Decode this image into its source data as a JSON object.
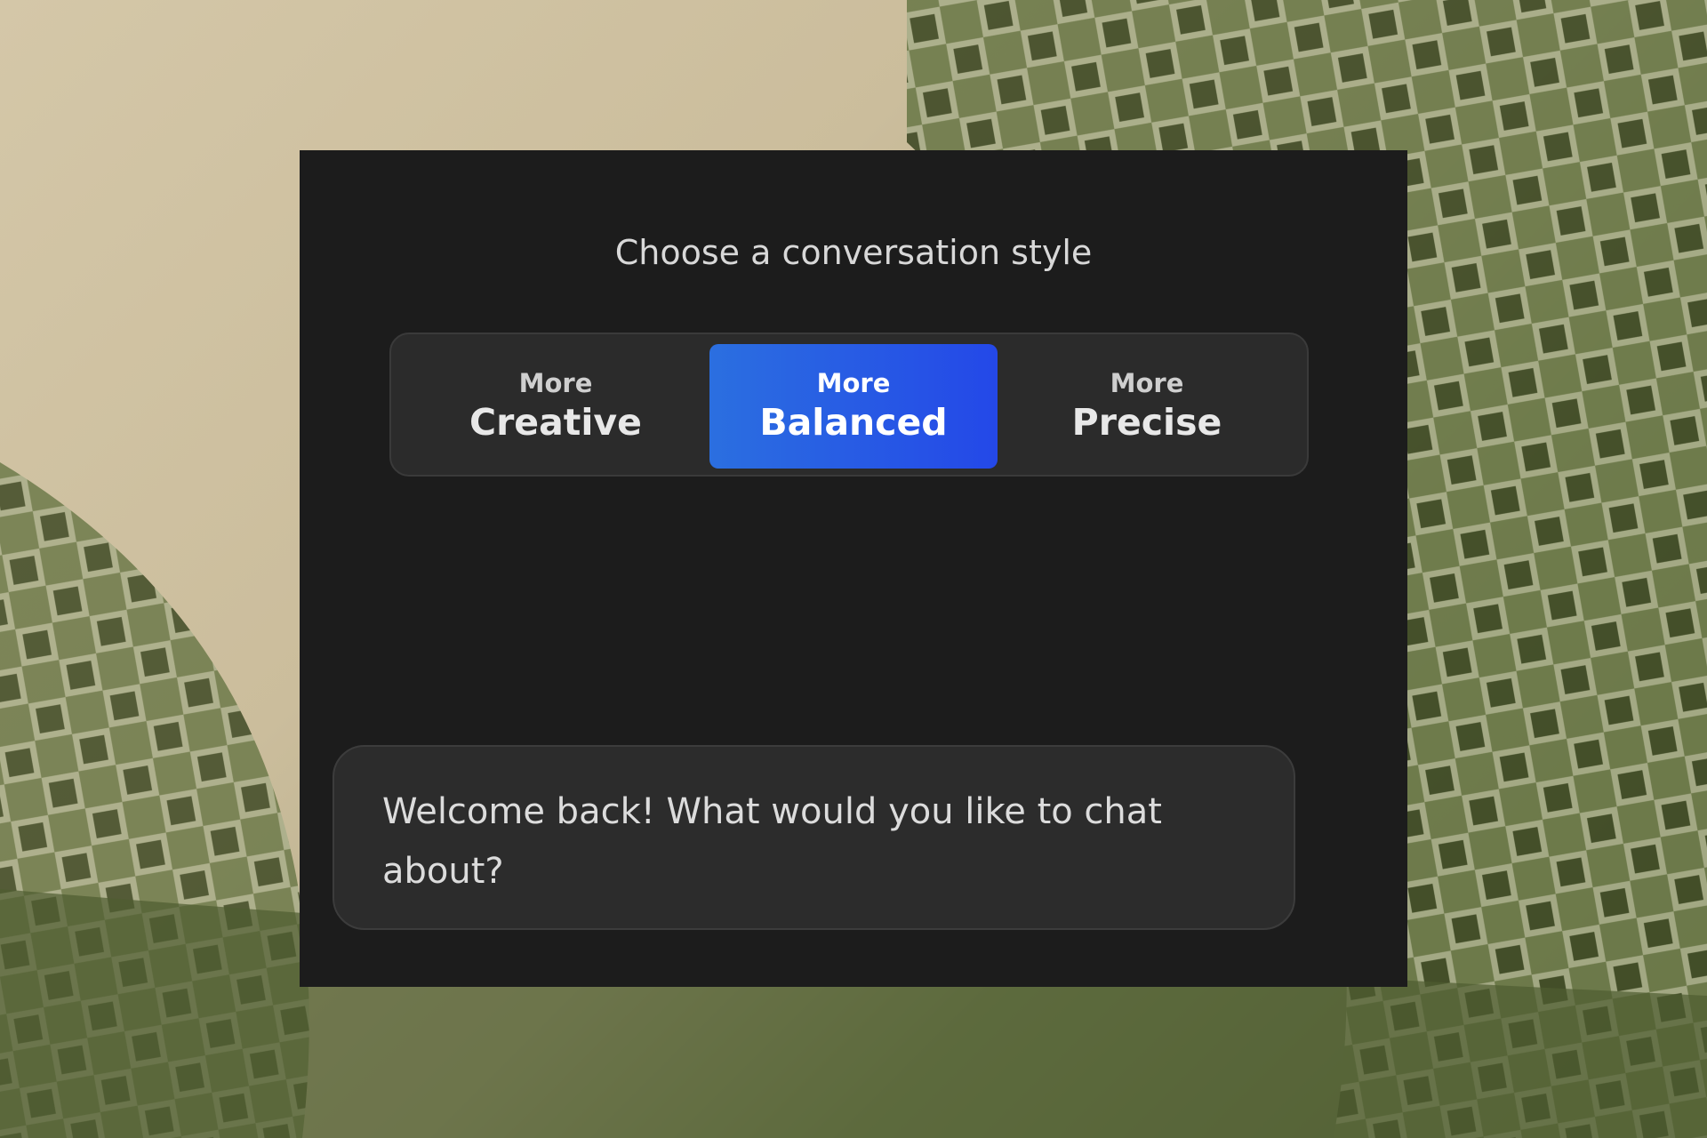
{
  "heading": "Choose a conversation style",
  "styles": [
    {
      "top": "More",
      "label": "Creative"
    },
    {
      "top": "More",
      "label": "Balanced"
    },
    {
      "top": "More",
      "label": "Precise"
    }
  ],
  "selected_style": "Balanced",
  "welcome_message": "Welcome back! What would you like to chat about?",
  "colors": {
    "panel": "#1c1c1c",
    "selected": "#2448e8",
    "text": "#dcdcdc"
  }
}
